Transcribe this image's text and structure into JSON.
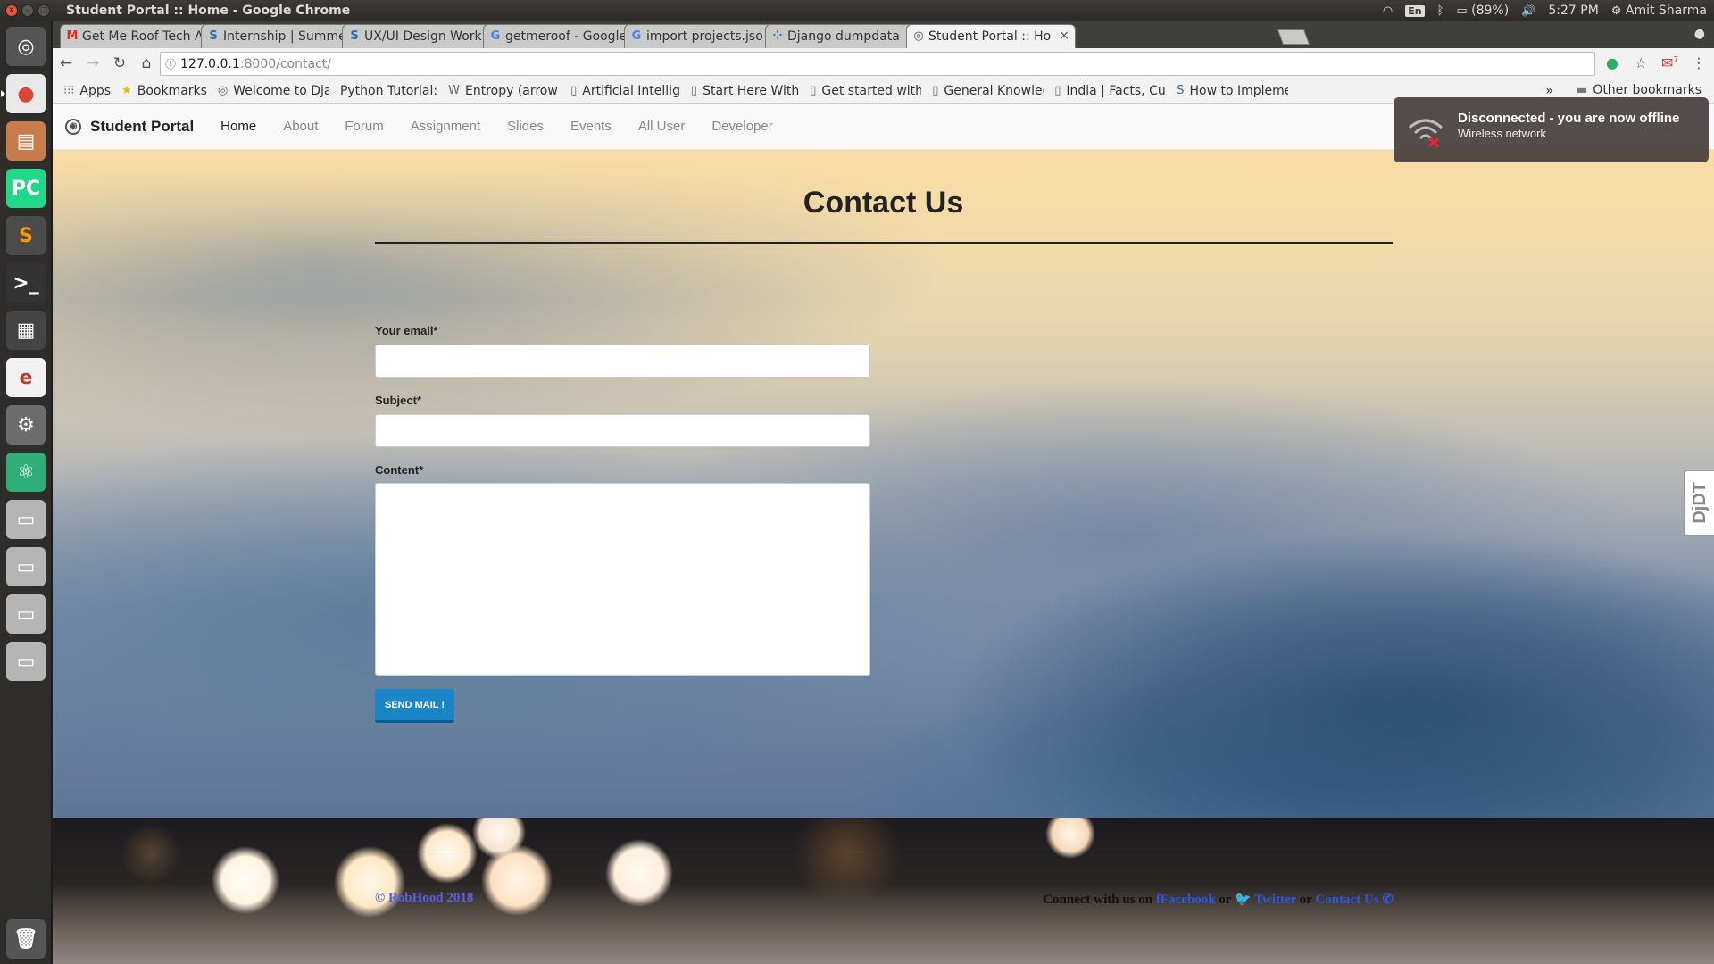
{
  "os": {
    "window_title": "Student Portal :: Home - Google Chrome",
    "tray": {
      "keyboard_lang": "En",
      "battery": "(89%)",
      "clock": "5:27 PM",
      "user": "Amit Sharma"
    },
    "launcher_items": [
      {
        "name": "ubuntu-dash-icon",
        "glyph": "◎",
        "bg": "#555"
      },
      {
        "name": "chrome-icon",
        "glyph": "●",
        "bg": "#e8e8e8",
        "color": "#db4437",
        "active": true
      },
      {
        "name": "files-icon",
        "glyph": "▤",
        "bg": "#c97c4b"
      },
      {
        "name": "pycharm-icon",
        "glyph": "PC",
        "bg": "#21d789"
      },
      {
        "name": "sublime-icon",
        "glyph": "S",
        "bg": "#4b4b4b",
        "color": "#ff9800"
      },
      {
        "name": "terminal-icon",
        "glyph": ">_",
        "bg": "#333"
      },
      {
        "name": "workspace-icon",
        "glyph": "▦",
        "bg": "#444"
      },
      {
        "name": "editor-icon",
        "glyph": "e",
        "bg": "#f2f2f2",
        "color": "#c0392b"
      },
      {
        "name": "settings-icon",
        "glyph": "⚙",
        "bg": "#6d6d6d"
      },
      {
        "name": "atom-icon",
        "glyph": "⚛",
        "bg": "#2fae7a"
      },
      {
        "name": "drive-icon-1",
        "glyph": "▭",
        "bg": "#b5b5b5"
      },
      {
        "name": "drive-icon-2",
        "glyph": "▭",
        "bg": "#b5b5b5"
      },
      {
        "name": "drive-icon-3",
        "glyph": "▭",
        "bg": "#b5b5b5"
      },
      {
        "name": "drive-icon-4",
        "glyph": "▭",
        "bg": "#b5b5b5"
      },
      {
        "name": "trash-icon",
        "glyph": "🗑",
        "bg": "#555"
      }
    ]
  },
  "browser": {
    "tabs": [
      {
        "favicon": "M",
        "fav_color": "#d93025",
        "label": "Get Me Roof Tech A"
      },
      {
        "favicon": "S",
        "fav_color": "#2d6cb5",
        "label": "Internship | Summe"
      },
      {
        "favicon": "S",
        "fav_color": "#2d6cb5",
        "label": "UX/UI Design Work"
      },
      {
        "favicon": "G",
        "fav_color": "#4285f4",
        "label": "getmeroof - Google"
      },
      {
        "favicon": "G",
        "fav_color": "#4285f4",
        "label": "import projects.jso"
      },
      {
        "favicon": "⁘",
        "fav_color": "#2a6db3",
        "label": "Django dumpdata"
      },
      {
        "favicon": "◎",
        "fav_color": "#555",
        "label": "Student Portal :: Ho",
        "active": true
      }
    ],
    "address": {
      "host": "127.0.0.1",
      "path": ":8000/contact/"
    },
    "mail_badge": "7",
    "bookmarks": [
      {
        "icon": "⁝⁝⁝",
        "label": "Apps"
      },
      {
        "icon": "★",
        "label": "Bookmarks"
      },
      {
        "icon": "◎",
        "label": "Welcome to Djar"
      },
      {
        "icon": "",
        "label": "Python Tutorial:"
      },
      {
        "icon": "W",
        "label": "Entropy (arrow c"
      },
      {
        "icon": "▯",
        "label": "Artificial Intellig"
      },
      {
        "icon": "▯",
        "label": "Start Here With"
      },
      {
        "icon": "▯",
        "label": "Get started with"
      },
      {
        "icon": "▯",
        "label": "General Knowlec"
      },
      {
        "icon": "▯",
        "label": "India | Facts, Cul"
      },
      {
        "icon": "S",
        "label": "How to Impleme"
      }
    ],
    "bookmarks_overflow": "»",
    "other_bookmarks": "Other bookmarks"
  },
  "site": {
    "brand": "Student Portal",
    "nav": [
      "Home",
      "About",
      "Forum",
      "Assignment",
      "Slides",
      "Events",
      "All User",
      "Developer"
    ],
    "active_nav": "Home",
    "heading": "Contact Us",
    "form": {
      "email_label": "Your email*",
      "email_value": "",
      "subject_label": "Subject*",
      "subject_value": "",
      "content_label": "Content*",
      "content_value": "",
      "submit_label": "SEND MAIL !"
    },
    "footer": {
      "copyright": "© RobHood 2018",
      "connect_prefix": "Connect with us on ",
      "facebook": "Facebook",
      "or1": " or ",
      "twitter": "Twitter",
      "or2": " or ",
      "contact": "Contact Us"
    }
  },
  "notification": {
    "title": "Disconnected - you are now offline",
    "subtitle": "Wireless network"
  },
  "debug_toolbar": {
    "label": "DjDT"
  },
  "colors": {
    "accent_button": "#1a86c7",
    "footer_link": "#2c55e8",
    "copyright": "#5560e6"
  }
}
